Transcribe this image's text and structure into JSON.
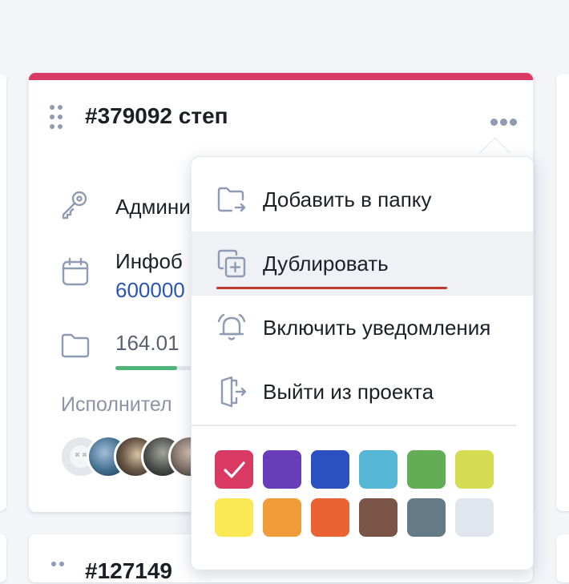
{
  "card": {
    "title": "#379092 степ",
    "accent_color": "#d93a63",
    "role_text": "Админи",
    "info_text": "Инфоб",
    "info_number": "600000",
    "size_text": "164.01",
    "size_progress": 0.64,
    "executors_label": "Исполнител"
  },
  "next_card": {
    "title": "#127149"
  },
  "menu": {
    "items": [
      {
        "label": "Добавить в папку",
        "icon": "folder-move-icon"
      },
      {
        "label": "Дублировать",
        "icon": "duplicate-icon"
      },
      {
        "label": "Включить уведомления",
        "icon": "bell-icon"
      },
      {
        "label": "Выйти из проекта",
        "icon": "exit-icon"
      }
    ],
    "colors": [
      {
        "name": "crimson",
        "hex": "#d93a63",
        "selected": true
      },
      {
        "name": "purple",
        "hex": "#6a3db8",
        "selected": false
      },
      {
        "name": "blue",
        "hex": "#2b50c0",
        "selected": false
      },
      {
        "name": "sky",
        "hex": "#55b7d3",
        "selected": false
      },
      {
        "name": "green",
        "hex": "#63ad57",
        "selected": false
      },
      {
        "name": "lime",
        "hex": "#d3dc53",
        "selected": false
      },
      {
        "name": "yellow",
        "hex": "#fbe857",
        "selected": false
      },
      {
        "name": "orange",
        "hex": "#f19b3a",
        "selected": false
      },
      {
        "name": "red-orange",
        "hex": "#ec6333",
        "selected": false
      },
      {
        "name": "brown",
        "hex": "#7a5446",
        "selected": false
      },
      {
        "name": "slate",
        "hex": "#647a86",
        "selected": false
      },
      {
        "name": "light-gray",
        "hex": "#e1e6ee",
        "selected": false
      }
    ]
  }
}
